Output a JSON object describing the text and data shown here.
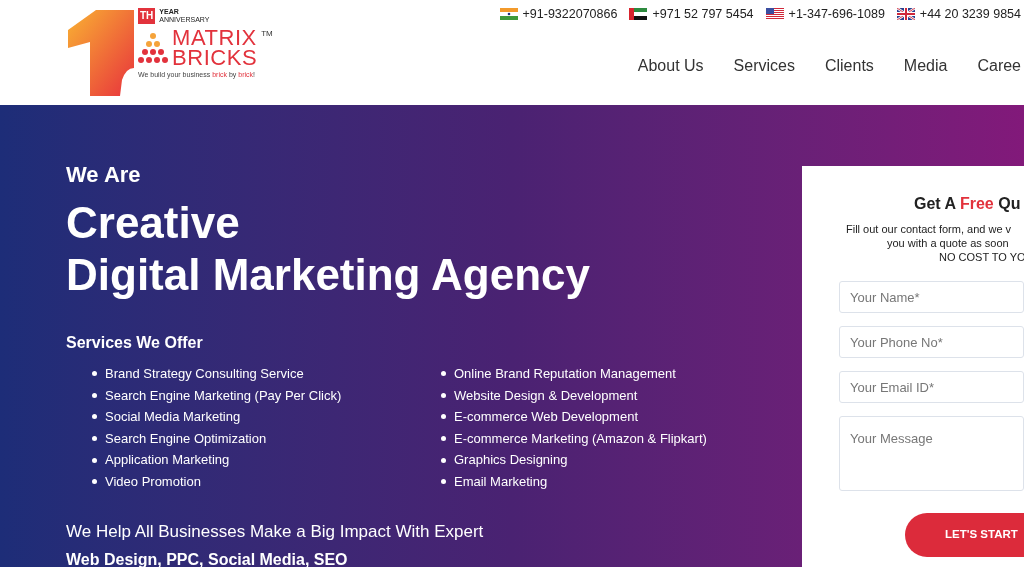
{
  "logo": {
    "badge": "TH",
    "year": "YEAR",
    "anniversary": "ANNIVERSARY",
    "name_lines": [
      "MATRIX",
      "BRICKS"
    ],
    "trademark": "TM",
    "tagline": [
      {
        "text": "We build your business ",
        "accent": false
      },
      {
        "text": "brick",
        "accent": true
      },
      {
        "text": " by ",
        "accent": false
      },
      {
        "text": "brick",
        "accent": true
      },
      {
        "text": "!",
        "accent": false
      }
    ]
  },
  "phones": [
    {
      "kind": "india",
      "number": "+91-9322070866"
    },
    {
      "kind": "uae",
      "number": "+971 52 797 5454"
    },
    {
      "kind": "usa",
      "number": "+1-347-696-1089"
    },
    {
      "kind": "uk",
      "number": "+44 20 3239 9854"
    }
  ],
  "nav": [
    "About Us",
    "Services",
    "Clients",
    "Media",
    "Caree"
  ],
  "hero": {
    "kicker": "We Are",
    "headline_lines": [
      "Creative",
      "Digital Marketing Agency"
    ],
    "services_heading": "Services We Offer",
    "services_columns": [
      [
        "Brand Strategy Consulting Service",
        "Search Engine Marketing (Pay Per Click)",
        "Social Media Marketing",
        "Search Engine Optimization",
        "Application Marketing",
        "Video Promotion"
      ],
      [
        "Online Brand Reputation Management",
        "Website Design & Development",
        "E-commerce Web Development",
        "E-commerce Marketing (Amazon & Flipkart)",
        "Graphics Designing",
        "Email Marketing"
      ]
    ],
    "tagline": "We Help All Businesses Make a Big Impact With Expert",
    "tagline_2": "Web Design, PPC, Social Media, SEO"
  },
  "quote_form": {
    "title": [
      {
        "text": "Get A ",
        "accent": false
      },
      {
        "text": "Free",
        "accent": true
      },
      {
        "text": " Qu",
        "accent": false
      }
    ],
    "description_lines": [
      "Fill out our contact form, and we v",
      "you with a quote as soon",
      "NO COST TO YO"
    ],
    "fields": [
      {
        "kind": "input",
        "placeholder": "Your Name*"
      },
      {
        "kind": "input",
        "placeholder": "Your Phone No*"
      },
      {
        "kind": "input",
        "placeholder": "Your Email ID*"
      },
      {
        "kind": "textarea",
        "placeholder": "Your Message"
      }
    ],
    "submit": "LET'S START"
  }
}
